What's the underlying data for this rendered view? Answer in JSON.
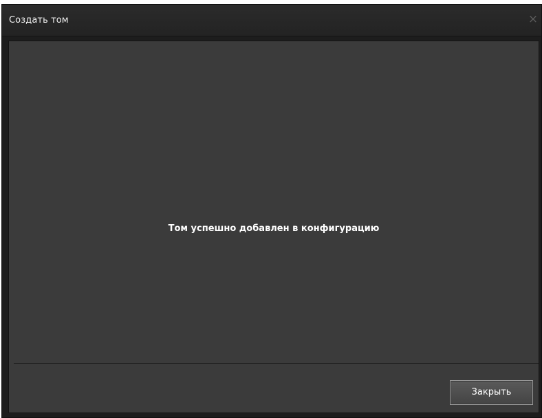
{
  "dialog": {
    "title": "Создать том",
    "close_glyph": "×",
    "message": "Том успешно добавлен в конфигурацию",
    "close_button_label": "Закрыть"
  },
  "colors": {
    "titlebar": "#262626",
    "content_background": "#3b3b3b",
    "frame": "#1d1d1d",
    "text": "#ffffff",
    "close_icon": "#5c5c5c"
  },
  "icons": {
    "close": "close-icon"
  }
}
